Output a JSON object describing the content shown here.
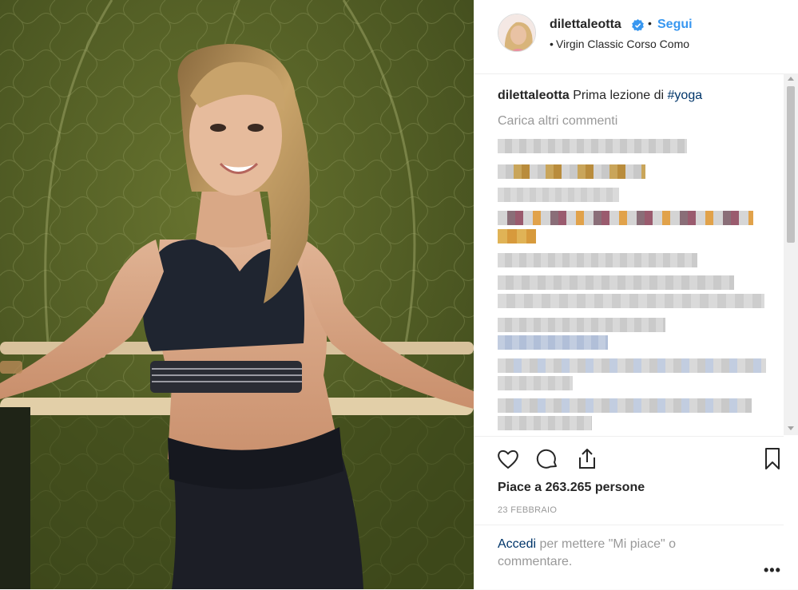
{
  "post": {
    "username": "dilettaleotta",
    "verified": true,
    "separator": "•",
    "follow_label": "Segui",
    "location_dot": "•",
    "location": "Virgin Classic Corso Como"
  },
  "caption": {
    "username": "dilettaleotta",
    "text": "Prima lezione di ",
    "hashtag": "#yoga"
  },
  "comments": {
    "load_more_label": "Carica altri commenti"
  },
  "engagement": {
    "likes_text": "Piace a 263.265 persone",
    "date": "23 FEBBRAIO"
  },
  "footer": {
    "login_link": "Accedi",
    "login_text": " per mettere \"Mi piace\" o commentare.",
    "more_label": "•••"
  },
  "colors": {
    "accent": "#3897f0",
    "link": "#003569",
    "muted": "#999999",
    "wall": "#56622b"
  },
  "icons": [
    "verified-badge-icon",
    "heart-icon",
    "comment-icon",
    "share-icon",
    "bookmark-icon",
    "ellipsis-icon"
  ]
}
